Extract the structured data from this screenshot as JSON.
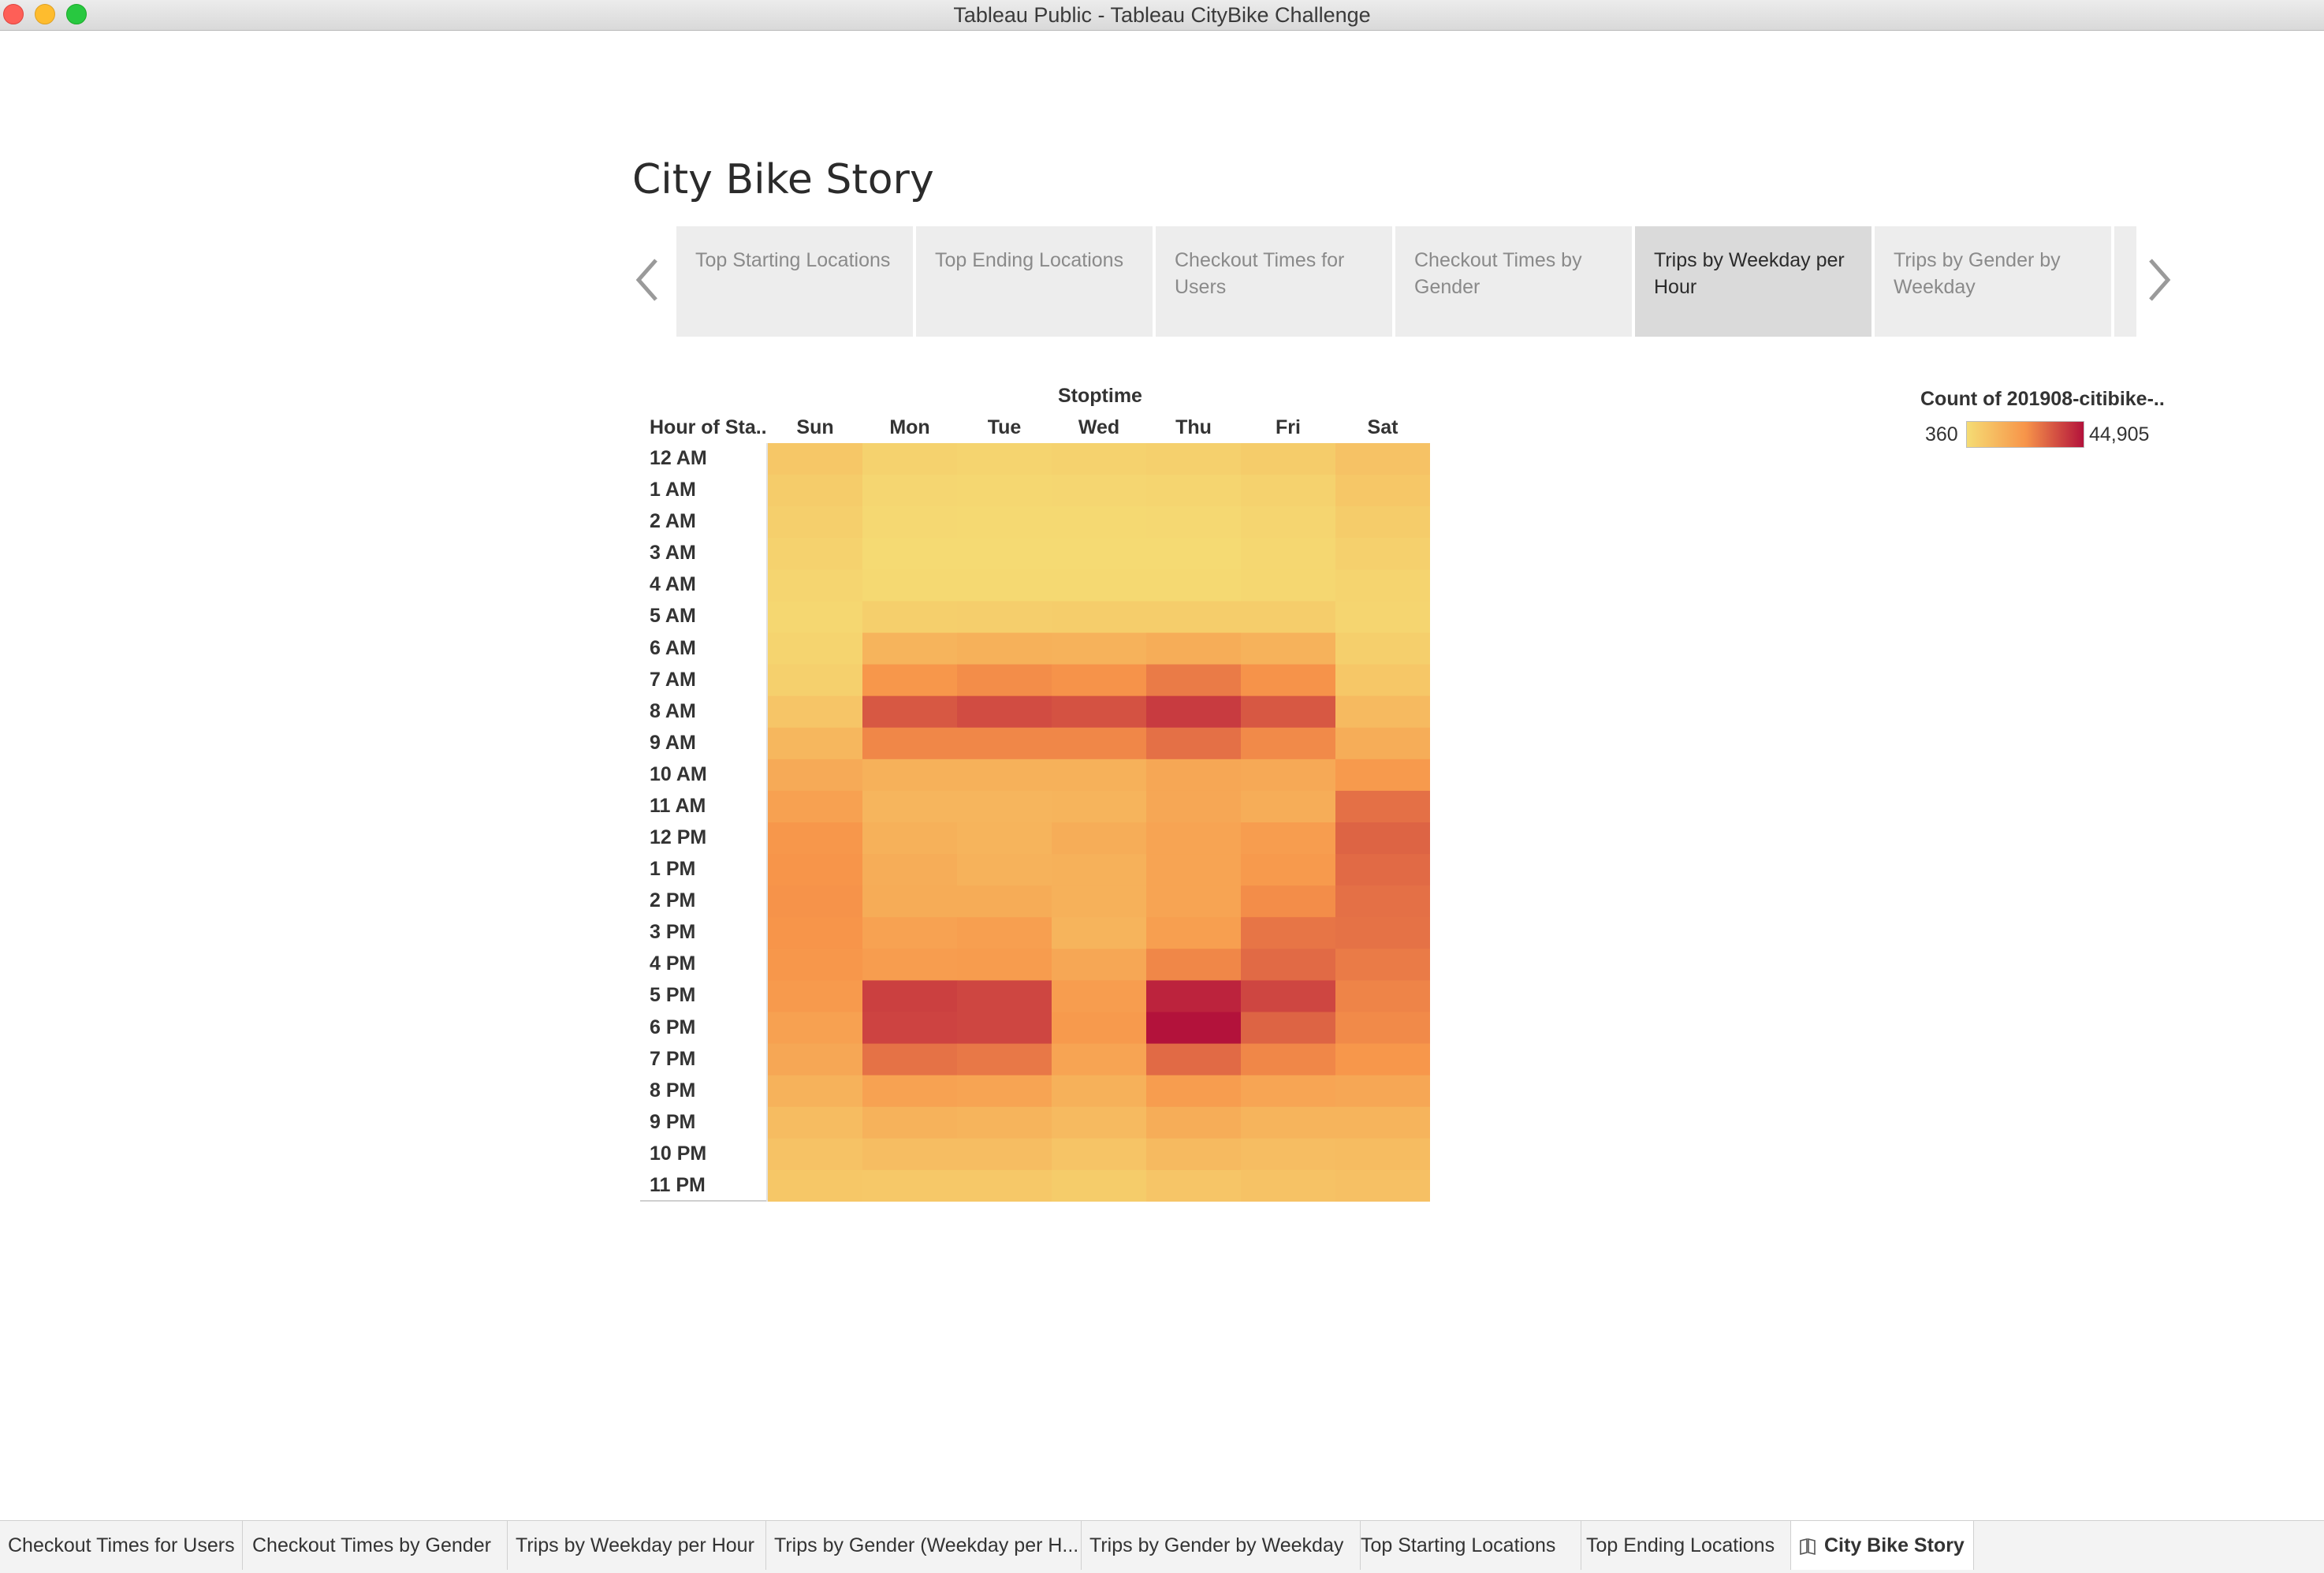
{
  "window": {
    "title": "Tableau Public - Tableau CityBike Challenge"
  },
  "story": {
    "title": "City Bike Story",
    "points": [
      {
        "label": "Top Starting Locations",
        "active": false
      },
      {
        "label": "Top Ending Locations",
        "active": false
      },
      {
        "label": "Checkout Times for Users",
        "active": false
      },
      {
        "label": "Checkout Times by Gender",
        "active": false
      },
      {
        "label": "Trips by Weekday per Hour",
        "active": true
      },
      {
        "label": "Trips by Gender by Weekday",
        "active": false
      }
    ]
  },
  "legend": {
    "title": "Count of 201908-citibike-..",
    "min_label": "360",
    "max_label": "44,905",
    "colors": {
      "low": "#f5dc74",
      "mid": "#f7954a",
      "high": "#b3123b"
    }
  },
  "chart_data": {
    "type": "heatmap",
    "title": "",
    "column_axis_title": "Stoptime",
    "row_axis_title": "Hour of Sta..",
    "columns": [
      "Sun",
      "Mon",
      "Tue",
      "Wed",
      "Thu",
      "Fri",
      "Sat"
    ],
    "rows": [
      "12 AM",
      "1 AM",
      "2 AM",
      "3 AM",
      "4 AM",
      "5 AM",
      "6 AM",
      "7 AM",
      "8 AM",
      "9 AM",
      "10 AM",
      "11 AM",
      "12 PM",
      "1 PM",
      "2 PM",
      "3 PM",
      "4 PM",
      "5 PM",
      "6 PM",
      "7 PM",
      "8 PM",
      "9 PM",
      "10 PM",
      "11 PM"
    ],
    "value_range": [
      360,
      44905
    ],
    "values": [
      [
        7000,
        3500,
        3000,
        3500,
        4000,
        5500,
        8500
      ],
      [
        5500,
        2200,
        2000,
        2200,
        2500,
        3500,
        7000
      ],
      [
        4500,
        1500,
        1200,
        1400,
        1600,
        2500,
        5500
      ],
      [
        3500,
        1000,
        900,
        1000,
        1100,
        1800,
        4200
      ],
      [
        2500,
        1300,
        1200,
        1300,
        1400,
        1800,
        3000
      ],
      [
        2000,
        4500,
        4700,
        5000,
        5200,
        5000,
        2500
      ],
      [
        2800,
        13000,
        14000,
        13500,
        15000,
        13500,
        4500
      ],
      [
        4000,
        22000,
        24000,
        23000,
        27000,
        23000,
        7000
      ],
      [
        7500,
        33000,
        35000,
        34000,
        38000,
        33000,
        11000
      ],
      [
        12000,
        25000,
        25000,
        25000,
        29000,
        24500,
        15000
      ],
      [
        16000,
        14000,
        14000,
        14000,
        17000,
        16500,
        21000
      ],
      [
        19000,
        12500,
        12500,
        13000,
        17000,
        15000,
        29000
      ],
      [
        22000,
        14000,
        13000,
        15000,
        18000,
        20000,
        31000
      ],
      [
        22500,
        15000,
        13500,
        14000,
        18000,
        21000,
        30000
      ],
      [
        23000,
        15500,
        15500,
        14000,
        18000,
        24000,
        29000
      ],
      [
        22500,
        18500,
        19500,
        13000,
        19500,
        28000,
        28500
      ],
      [
        22000,
        20000,
        20500,
        17000,
        25000,
        30000,
        27000
      ],
      [
        21000,
        37000,
        36000,
        20000,
        42000,
        36000,
        25500
      ],
      [
        19000,
        36500,
        36000,
        21000,
        44905,
        31000,
        24500
      ],
      [
        17000,
        28500,
        27500,
        18000,
        30000,
        25000,
        22000
      ],
      [
        13500,
        18500,
        18000,
        14000,
        20000,
        17500,
        17000
      ],
      [
        10500,
        13500,
        13000,
        11000,
        15000,
        13000,
        13000
      ],
      [
        8500,
        10000,
        10000,
        8000,
        11000,
        10000,
        10500
      ],
      [
        7000,
        6500,
        6500,
        5500,
        7500,
        8500,
        9000
      ]
    ]
  },
  "tabs": [
    {
      "label": "Checkout Times for Users",
      "active": false
    },
    {
      "label": "Checkout Times by Gender",
      "active": false
    },
    {
      "label": "Trips by Weekday per Hour",
      "active": false
    },
    {
      "label": "Trips by Gender (Weekday per H...",
      "active": false
    },
    {
      "label": "Trips by Gender by Weekday",
      "active": false
    },
    {
      "label": "Top Starting Locations",
      "active": false
    },
    {
      "label": "Top Ending Locations",
      "active": false
    },
    {
      "label": "City Bike Story",
      "active": true,
      "icon": "story-icon"
    }
  ]
}
